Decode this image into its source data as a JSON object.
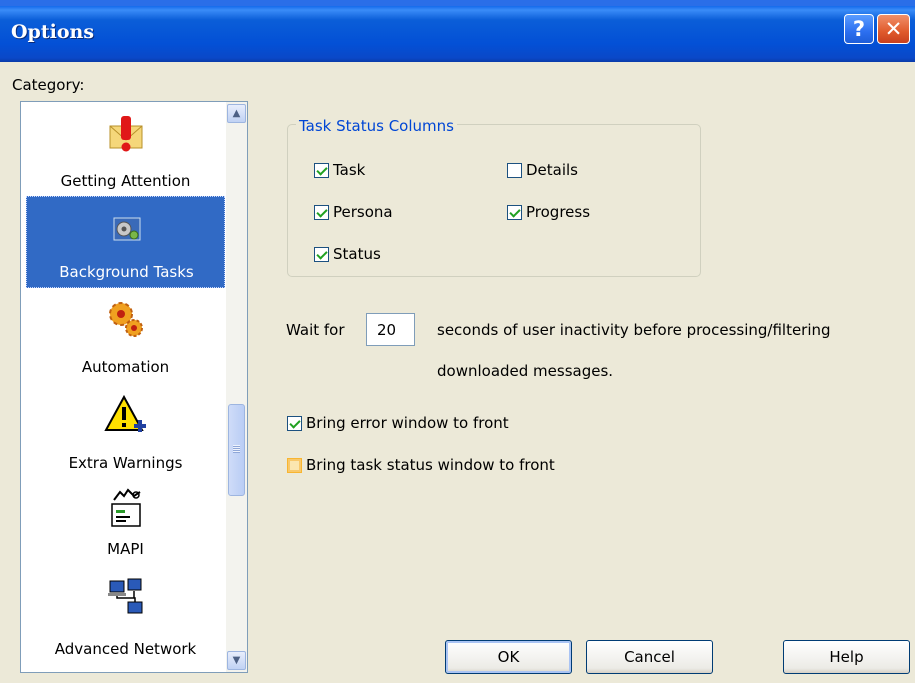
{
  "window": {
    "title": "Options"
  },
  "category_label": "Category:",
  "categories": [
    {
      "label": "Getting Attention",
      "icon": "exclamation-envelope-icon"
    },
    {
      "label": "Background Tasks",
      "icon": "background-tasks-icon",
      "selected": true
    },
    {
      "label": "Automation",
      "icon": "gears-icon"
    },
    {
      "label": "Extra Warnings",
      "icon": "warning-plus-icon"
    },
    {
      "label": "MAPI",
      "icon": "mapi-icon"
    },
    {
      "label": "Advanced Network",
      "icon": "network-computers-icon"
    }
  ],
  "task_status": {
    "title": "Task Status Columns",
    "task": {
      "label": "Task",
      "checked": true
    },
    "details": {
      "label": "Details",
      "checked": false
    },
    "persona": {
      "label": "Persona",
      "checked": true
    },
    "progress": {
      "label": "Progress",
      "checked": true
    },
    "status": {
      "label": "Status",
      "checked": true
    }
  },
  "wait": {
    "prefix": "Wait for",
    "value": "20",
    "suffix_line1": "seconds of user inactivity before processing/filtering",
    "suffix_line2": "downloaded messages."
  },
  "options": {
    "error_front": {
      "label": "Bring error window to front",
      "checked": true
    },
    "task_front": {
      "label": "Bring task status window to front",
      "checked": false
    }
  },
  "buttons": {
    "ok": "OK",
    "cancel": "Cancel",
    "help": "Help"
  },
  "colors": {
    "title_bar": "#0058e6",
    "selection": "#316ac5",
    "group_title": "#0046d5"
  }
}
